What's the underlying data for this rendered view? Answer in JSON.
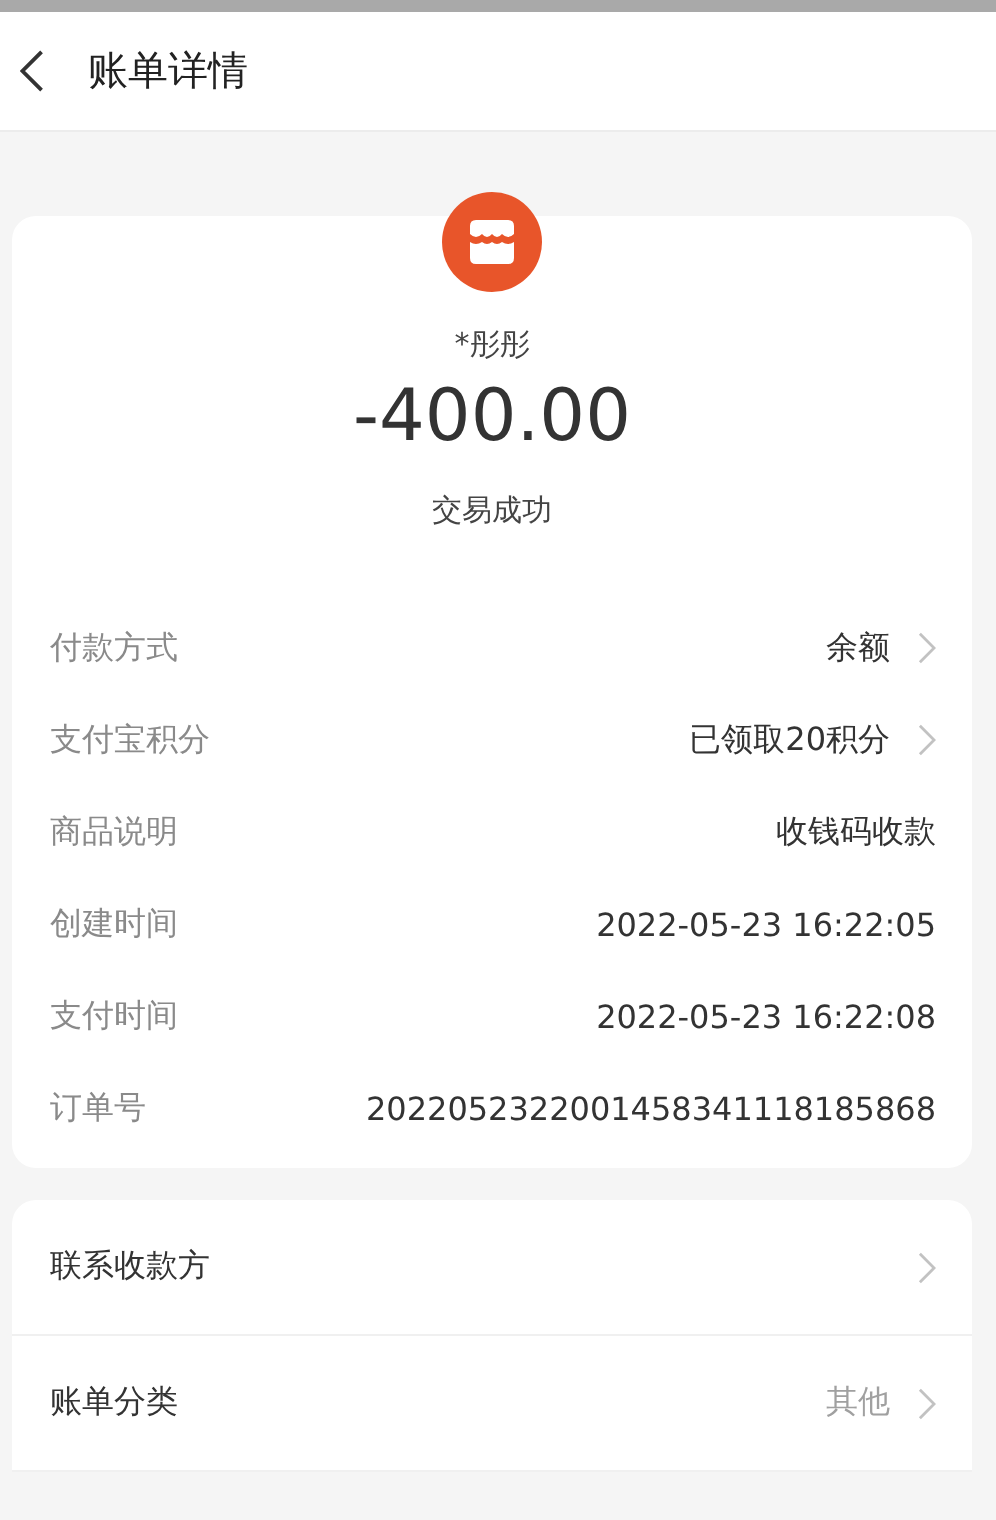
{
  "header": {
    "title": "账单详情"
  },
  "summary": {
    "name": "*彤彤",
    "amount": "-400.00",
    "status": "交易成功"
  },
  "details": [
    {
      "label": "付款方式",
      "value": "余额",
      "link": true
    },
    {
      "label": "支付宝积分",
      "value": "已领取20积分",
      "link": true
    },
    {
      "label": "商品说明",
      "value": "收钱码收款",
      "link": false
    },
    {
      "label": "创建时间",
      "value": "2022-05-23 16:22:05",
      "link": false
    },
    {
      "label": "支付时间",
      "value": "2022-05-23 16:22:08",
      "link": false
    },
    {
      "label": "订单号",
      "value": "2022052322001458341118185868",
      "link": false
    }
  ],
  "actions": [
    {
      "label": "联系收款方",
      "link": true
    },
    {
      "label": "账单分类",
      "value": "其他",
      "link": true
    }
  ]
}
